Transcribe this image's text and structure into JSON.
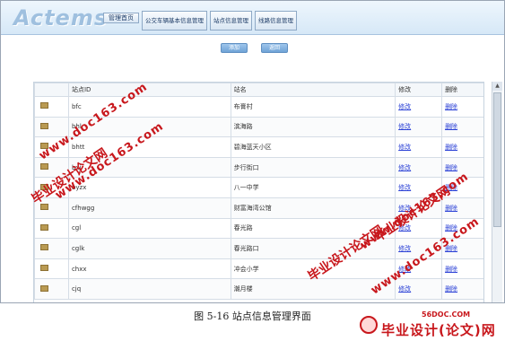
{
  "app": {
    "logo": "Actems"
  },
  "nav": {
    "tabs": [
      {
        "label": "管理首页"
      },
      {
        "label": "公交车辆基本信息管理"
      },
      {
        "label": "站点信息管理"
      },
      {
        "label": "线路信息管理"
      }
    ]
  },
  "actions": {
    "add_label": "添加",
    "back_label": "返回"
  },
  "table": {
    "headers": [
      "",
      "站点ID",
      "站名",
      "修改",
      "删除"
    ],
    "rows": [
      {
        "id": "bfc",
        "name": "布膏村",
        "edit": "修改",
        "delete": "删除"
      },
      {
        "id": "bhl",
        "name": "滨海路",
        "edit": "修改",
        "delete": "删除"
      },
      {
        "id": "bhtt",
        "name": "碧海蓝天小区",
        "edit": "修改",
        "delete": "删除"
      },
      {
        "id": "bxj",
        "name": "步行街口",
        "edit": "修改",
        "delete": "删除"
      },
      {
        "id": "byzx",
        "name": "八一中学",
        "edit": "修改",
        "delete": "删除"
      },
      {
        "id": "cfhwgg",
        "name": "财富海湾公馆",
        "edit": "修改",
        "delete": "删除"
      },
      {
        "id": "cgl",
        "name": "春光路",
        "edit": "修改",
        "delete": "删除"
      },
      {
        "id": "cglk",
        "name": "春光路口",
        "edit": "修改",
        "delete": "删除"
      },
      {
        "id": "chxx",
        "name": "冲会小学",
        "edit": "修改",
        "delete": "删除"
      },
      {
        "id": "cjq",
        "name": "潮月楼",
        "edit": "修改",
        "delete": "删除"
      }
    ]
  },
  "watermarks": {
    "cn": "毕业设计论文网",
    "url": "www.doc163.com"
  },
  "caption": "图 5-16  站点信息管理界面",
  "corner": {
    "site": "56DOC.COM",
    "brand": "毕业设计(论文)网"
  }
}
